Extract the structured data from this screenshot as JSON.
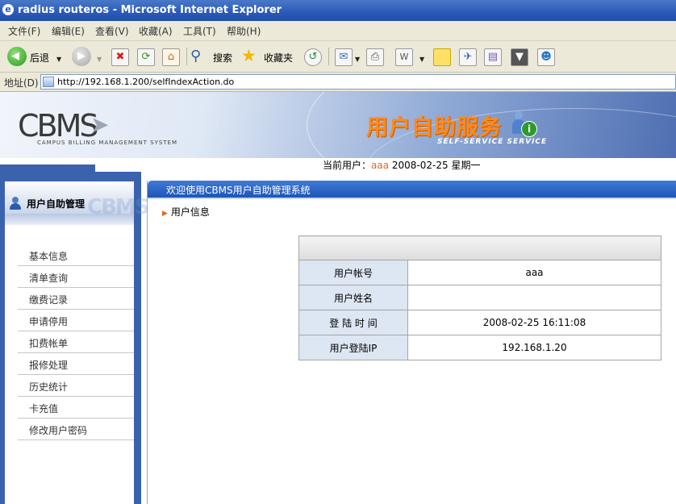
{
  "window": {
    "title": "radius routeros - Microsoft Internet Explorer"
  },
  "menu": [
    "文件(F)",
    "编辑(E)",
    "查看(V)",
    "收藏(A)",
    "工具(T)",
    "帮助(H)"
  ],
  "toolbar": {
    "back_label": "后退",
    "search_label": "搜索",
    "favorites_label": "收藏夹"
  },
  "address": {
    "label": "地址(D)",
    "url": "http://192.168.1.200/selfIndexAction.do"
  },
  "header": {
    "logo": "CBMS",
    "logo_sub": "CAMPUS BILLING MANAGEMENT SYSTEM",
    "service_title": "用户自助服务",
    "service_sub": "SELF-SERVICE SERVICE",
    "current_user_label": "当前用户：",
    "current_user": "aaa",
    "date": "2008-02-25",
    "weekday": "星期一"
  },
  "sidebar": {
    "title": "用户自助管理",
    "watermark": "CBMS",
    "items": [
      {
        "label": "基本信息"
      },
      {
        "label": "清单查询"
      },
      {
        "label": "缴费记录"
      },
      {
        "label": "申请停用"
      },
      {
        "label": "扣费帐单"
      },
      {
        "label": "报修处理"
      },
      {
        "label": "历史统计"
      },
      {
        "label": "卡充值"
      },
      {
        "label": "修改用户密码"
      }
    ]
  },
  "main": {
    "welcome": "欢迎使用CBMS用户自助管理系统",
    "section_title": "用户信息",
    "rows": [
      {
        "key": "用户帐号",
        "value": "aaa"
      },
      {
        "key": "用户姓名",
        "value": ""
      },
      {
        "key": "登 陆 时 间",
        "value": "2008-02-25 16:11:08"
      },
      {
        "key": "用户登陆IP",
        "value": "192.168.1.20"
      }
    ]
  },
  "colors": {
    "accent_blue": "#3b63ad",
    "orange": "#ff8a1a",
    "user_highlight": "#e0691a"
  }
}
